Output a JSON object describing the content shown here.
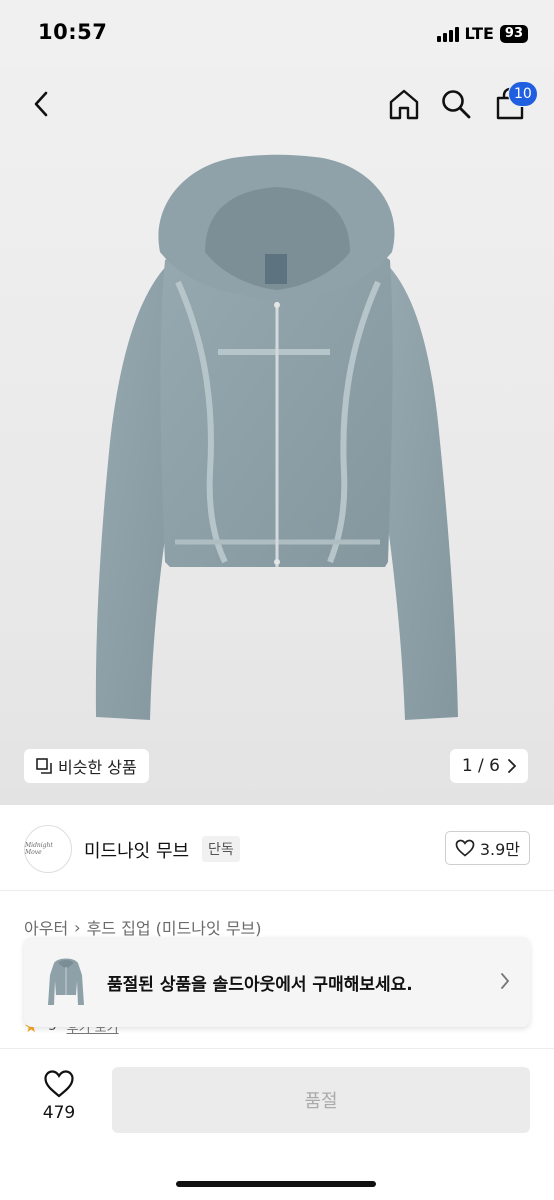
{
  "status_bar": {
    "time": "10:57",
    "network": "LTE",
    "battery": "93"
  },
  "nav": {
    "back_icon": "chevron-left-icon",
    "home_icon": "home-icon",
    "search_icon": "search-icon",
    "cart_icon": "shopping-bag-icon",
    "cart_badge": "10"
  },
  "hero": {
    "similar_button": "비슷한 상품",
    "page_indicator": "1 / 6",
    "current_page": 1,
    "total_pages": 6,
    "colors": {
      "background": "#efefef",
      "product": "#8ea1a8"
    }
  },
  "brand": {
    "logo_text": "Midnight Move",
    "name": "미드나잇 무브",
    "tag": "단독",
    "likes": "3.9만"
  },
  "category": {
    "first": "아우터",
    "separator": "›",
    "second": "후드 집업 (미드나잇 무브)"
  },
  "rating_peek": {
    "score": "5",
    "link": "후기 보기"
  },
  "soldout_banner": {
    "text": "품절된 상품을 솔드아웃에서 구매해보세요."
  },
  "bottom_bar": {
    "like_count": "479",
    "buy_button": "품절"
  },
  "colors": {
    "accent": "#1f5fe0",
    "disabled_bg": "#ebebeb",
    "disabled_text": "#aaaaaa"
  }
}
